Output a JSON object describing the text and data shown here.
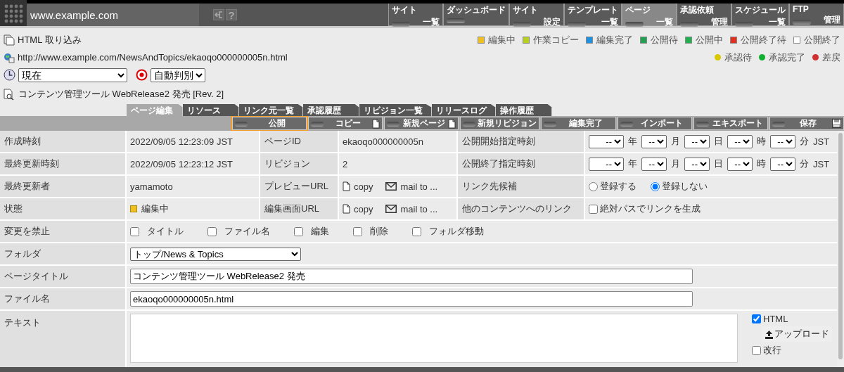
{
  "header": {
    "site": "www.example.com",
    "help": "?",
    "nav": [
      {
        "top": "サイト",
        "bottom": "一覧",
        "selected": false
      },
      {
        "top": "ダッシュボード",
        "selected": false
      },
      {
        "top": "サイト",
        "bottom": "設定",
        "selected": false
      },
      {
        "top": "テンプレート",
        "bottom": "一覧",
        "selected": false
      },
      {
        "top": "ページ",
        "bottom": "一覧",
        "selected": true
      },
      {
        "top": "承認依頼",
        "bottom": "管理",
        "selected": false
      },
      {
        "top": "スケジュール",
        "bottom": "一覧",
        "selected": false
      },
      {
        "top": "FTP",
        "bottom": "管理",
        "selected": false
      }
    ]
  },
  "info": {
    "import_link": "HTML 取り込み",
    "url": "http://www.example.com/NewsAndTopics/ekaoqo000000005n.html",
    "period": "現在",
    "encoding": "自動判別",
    "page_title": "コンテンツ管理ツール WebRelease2 発売 [Rev. 2]",
    "status_legend": [
      {
        "label": "編集中",
        "color": "#f0c020"
      },
      {
        "label": "作業コピー",
        "color": "#b8d020"
      },
      {
        "label": "編集完了",
        "color": "#2090e0"
      },
      {
        "label": "公開待",
        "color": "#20a050"
      },
      {
        "label": "公開中",
        "color": "#20b050"
      },
      {
        "label": "公開終了待",
        "color": "#e03020"
      },
      {
        "label": "公開終了",
        "color": "#ffffff"
      }
    ],
    "approval_legend": [
      {
        "label": "承認待",
        "color": "#d8c800"
      },
      {
        "label": "承認完了",
        "color": "#10b030"
      },
      {
        "label": "差戻",
        "color": "#d03030"
      }
    ]
  },
  "tabs": [
    {
      "label": "ページ編集",
      "selected": true
    },
    {
      "label": "リソース",
      "selected": false
    },
    {
      "label": "リンク元一覧",
      "selected": false
    },
    {
      "label": "承認履歴",
      "selected": false
    },
    {
      "label": "リビジョン一覧",
      "selected": false
    },
    {
      "label": "リリースログ",
      "selected": false
    },
    {
      "label": "操作履歴",
      "selected": false
    }
  ],
  "actions": [
    {
      "label": "公開",
      "focused": true,
      "kind": "plain"
    },
    {
      "label": "コピー",
      "focused": false,
      "kind": "copy"
    },
    {
      "label": "新規ページ",
      "focused": false,
      "kind": "page"
    },
    {
      "label": "新規リビジョン",
      "focused": false,
      "kind": "plain"
    },
    {
      "label": "編集完了",
      "focused": false,
      "kind": "plain"
    },
    {
      "label": "インポート",
      "focused": false,
      "kind": "plain"
    },
    {
      "label": "エキスポート",
      "focused": false,
      "kind": "plain"
    },
    {
      "label": "保存",
      "focused": false,
      "kind": "save"
    }
  ],
  "form": {
    "info_rows": [
      {
        "label": "作成時刻",
        "value": {
          "kind": "text",
          "text": "2022/09/05 12:23:09 JST"
        },
        "label_2": "ページID",
        "value_2": {
          "kind": "text",
          "text": "ekaoqo000000005n"
        },
        "label_3": "公開開始指定時刻",
        "value_3": {
          "kind": "datetime",
          "fields": [
            {
              "value": "--",
              "unit": "年"
            },
            {
              "value": "--",
              "unit": "月"
            },
            {
              "value": "--",
              "unit": "日"
            },
            {
              "value": "--",
              "unit": "時"
            },
            {
              "value": "--",
              "unit": "分"
            }
          ],
          "zone": "JST"
        }
      },
      {
        "label": "最終更新時刻",
        "value": {
          "kind": "text",
          "text": "2022/09/05 12:23:12 JST"
        },
        "label_2": "リビジョン",
        "value_2": {
          "kind": "text",
          "text": "2"
        },
        "label_3": "公開終了指定時刻",
        "value_3": {
          "kind": "datetime",
          "fields": [
            {
              "value": "--",
              "unit": "年"
            },
            {
              "value": "--",
              "unit": "月"
            },
            {
              "value": "--",
              "unit": "日"
            },
            {
              "value": "--",
              "unit": "時"
            },
            {
              "value": "--",
              "unit": "分"
            }
          ],
          "zone": "JST"
        }
      },
      {
        "label": "最終更新者",
        "value": {
          "kind": "text",
          "text": "yamamoto"
        },
        "label_2": "プレビューURL",
        "value_2": {
          "kind": "links",
          "copy": "copy",
          "mail": "mail to ..."
        },
        "label_3": "リンク先候補",
        "value_3": {
          "kind": "radios",
          "options": [
            {
              "label": "登録する",
              "selected": false
            },
            {
              "label": "登録しない",
              "selected": true
            }
          ]
        }
      },
      {
        "label": "状態",
        "value": {
          "kind": "status",
          "text": "編集中",
          "color": "#f0c020"
        },
        "label_2": "編集画面URL",
        "value_2": {
          "kind": "links",
          "copy": "copy",
          "mail": "mail to ..."
        },
        "label_3": "他のコンテンツへのリンク",
        "value_3": {
          "kind": "checks",
          "options": [
            {
              "label": "絶対パスでリンクを生成",
              "checked": false
            }
          ]
        }
      }
    ],
    "rows": [
      {
        "label": "変更を禁止",
        "value": {
          "kind": "checks",
          "options": [
            {
              "label": "タイトル",
              "checked": false
            },
            {
              "label": "ファイル名",
              "checked": false
            },
            {
              "label": "編集",
              "checked": false
            },
            {
              "label": "削除",
              "checked": false
            },
            {
              "label": "フォルダ移動",
              "checked": false
            }
          ]
        }
      },
      {
        "label": "フォルダ",
        "value": {
          "kind": "select",
          "text": "トップ/News & Topics"
        }
      },
      {
        "label": "ページタイトル",
        "value": {
          "kind": "input",
          "text": "コンテンツ管理ツール WebRelease2 発売"
        }
      },
      {
        "label": "ファイル名",
        "value": {
          "kind": "input",
          "text": "ekaoqo000000005n.html"
        }
      },
      {
        "label": "テキスト",
        "value": {
          "kind": "textarea",
          "html": {
            "label": "HTML",
            "checked": true
          },
          "upload": "アップロード",
          "wrap": {
            "label": "改行",
            "checked": false
          }
        }
      }
    ]
  }
}
